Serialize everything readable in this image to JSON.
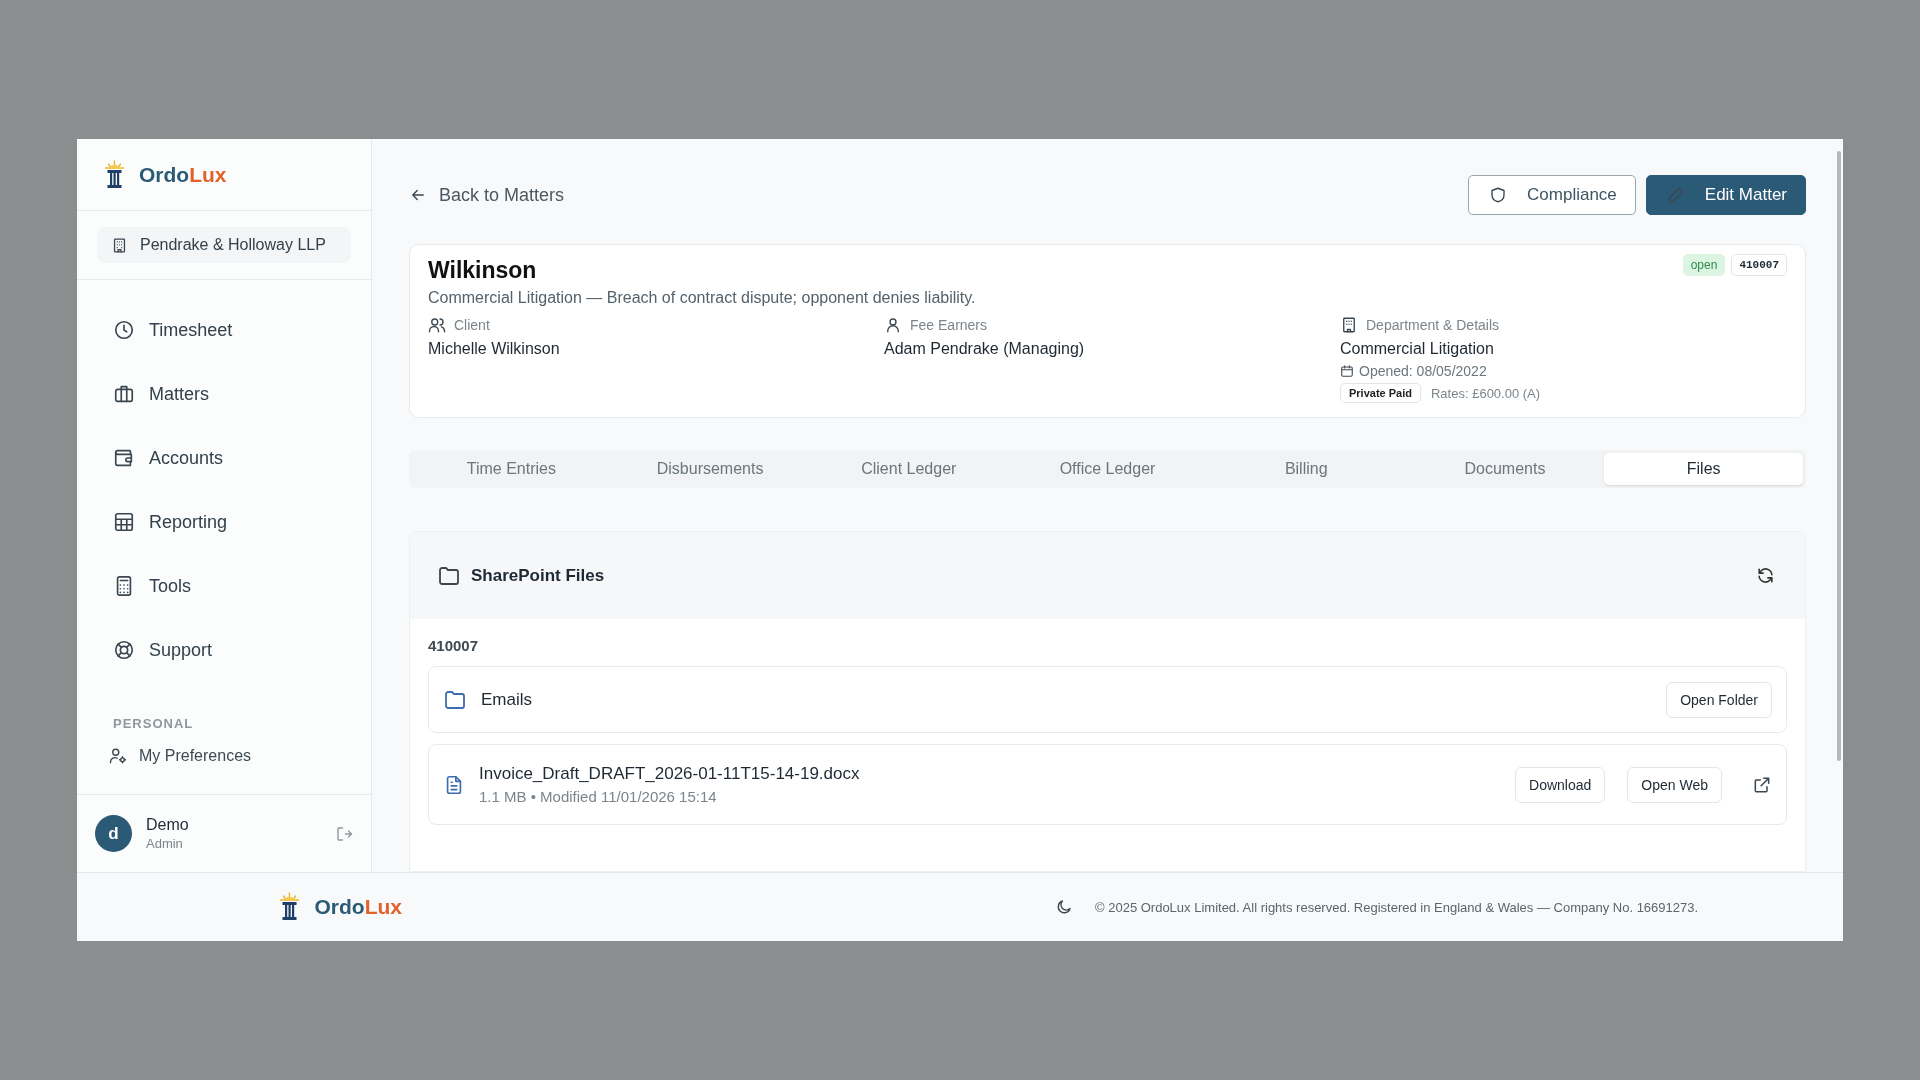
{
  "brand": {
    "part1": "Ordo",
    "part2": "Lux"
  },
  "firm": "Pendrake & Holloway LLP",
  "nav": [
    {
      "label": "Timesheet"
    },
    {
      "label": "Matters"
    },
    {
      "label": "Accounts"
    },
    {
      "label": "Reporting"
    },
    {
      "label": "Tools"
    },
    {
      "label": "Support"
    }
  ],
  "personal": {
    "heading": "PERSONAL",
    "items": [
      {
        "label": "My Preferences"
      }
    ]
  },
  "user": {
    "initial": "d",
    "name": "Demo",
    "role": "Admin"
  },
  "back_link": "Back to Matters",
  "actions": [
    {
      "label": "Compliance",
      "kind": "outline"
    },
    {
      "label": "Edit Matter",
      "kind": "primary"
    }
  ],
  "matter": {
    "title": "Wilkinson",
    "description": "Commercial Litigation — Breach of contract dispute; opponent denies liability.",
    "status": "open",
    "number": "410007",
    "client": {
      "label": "Client",
      "value": "Michelle Wilkinson"
    },
    "fee_earners": {
      "label": "Fee Earners",
      "value": "Adam Pendrake (Managing)"
    },
    "department": {
      "label": "Department & Details",
      "value": "Commercial Litigation",
      "opened": "Opened: 08/05/2022",
      "funding": "Private Paid",
      "rates": "Rates: £600.00 (A)"
    }
  },
  "tabs": [
    {
      "label": "Time Entries",
      "selected": false
    },
    {
      "label": "Disbursements",
      "selected": false
    },
    {
      "label": "Client Ledger",
      "selected": false
    },
    {
      "label": "Office Ledger",
      "selected": false
    },
    {
      "label": "Billing",
      "selected": false
    },
    {
      "label": "Documents",
      "selected": false
    },
    {
      "label": "Files",
      "selected": true
    }
  ],
  "files_panel": {
    "title": "SharePoint Files",
    "folder_path": "410007",
    "items": [
      {
        "kind": "folder",
        "name": "Emails",
        "actions": [
          "Open Folder"
        ]
      },
      {
        "kind": "file",
        "name": "Invoice_Draft_DRAFT_2026-01-11T15-14-19.docx",
        "meta": "1.1 MB • Modified 11/01/2026 15:14",
        "actions": [
          "Download",
          "Open Web"
        ],
        "external_link": true
      }
    ]
  },
  "footer": {
    "brand": {
      "part1": "Ordo",
      "part2": "Lux"
    },
    "copyright": "© 2025 OrdoLux Limited. All rights reserved. Registered in England & Wales — Company No. 16691273."
  }
}
